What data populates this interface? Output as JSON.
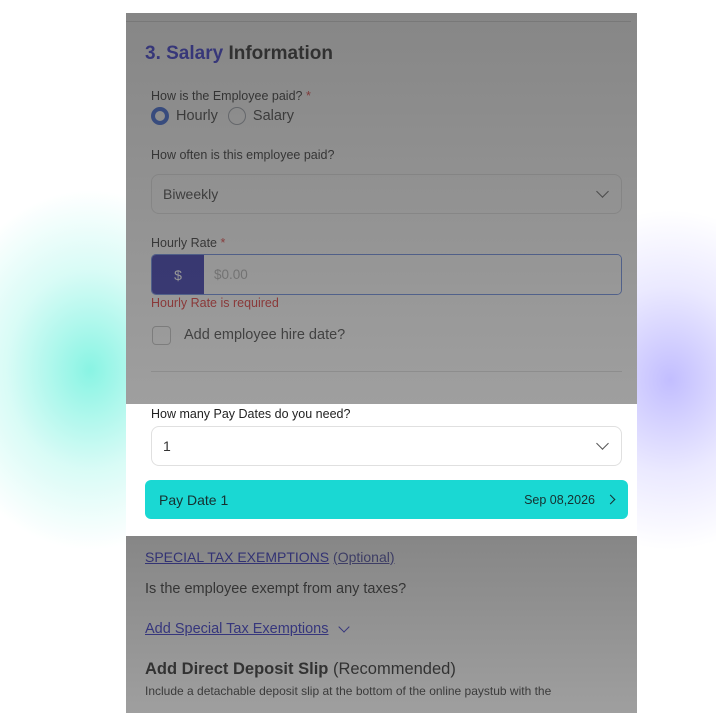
{
  "section": {
    "number": "3. Salary",
    "title_rest": "Information"
  },
  "pay_type": {
    "label": "How is the Employee paid?",
    "required_mark": "*",
    "options": [
      "Hourly",
      "Salary"
    ],
    "selected": "Hourly"
  },
  "pay_frequency": {
    "label": "How often is this employee paid?",
    "value": "Biweekly"
  },
  "hourly_rate": {
    "label": "Hourly Rate",
    "required_mark": "*",
    "currency_symbol": "$",
    "placeholder": "$0.00",
    "error": "Hourly Rate is required"
  },
  "hire_date": {
    "label": "Add employee hire date?",
    "checked": false
  },
  "pay_dates": {
    "label": "How many Pay Dates do you need?",
    "value": "1",
    "items": [
      {
        "label": "Pay Date 1",
        "date": "Sep 08,2026"
      }
    ]
  },
  "tax_exemptions": {
    "title": "SPECIAL TAX EXEMPTIONS",
    "optional": "(Optional)",
    "question": "Is the employee exempt from any taxes?",
    "add_link": "Add Special Tax Exemptions"
  },
  "direct_deposit": {
    "title": "Add Direct Deposit Slip",
    "tag": "(Recommended)",
    "description": "Include a detachable deposit slip at the bottom of the online paystub with the"
  },
  "colors": {
    "accent_blue": "#2b2bd6",
    "currency_badge": "#2323a8",
    "paydate_teal": "#1ad8d3",
    "error_red": "#dd2222"
  }
}
